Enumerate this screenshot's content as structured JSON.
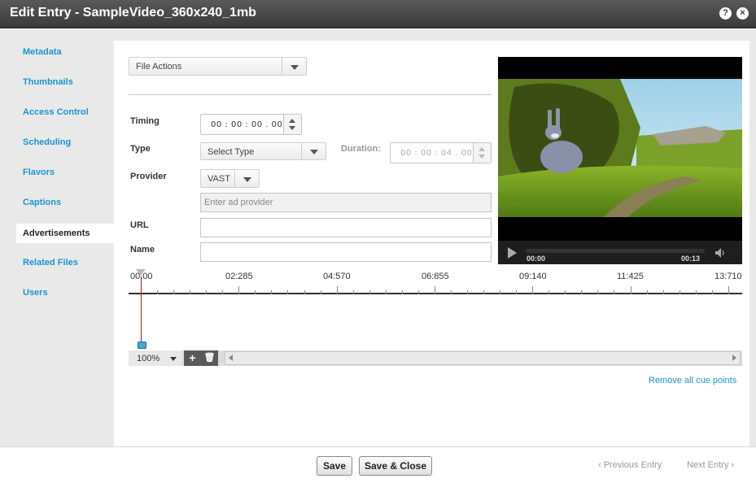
{
  "window": {
    "title": "Edit Entry - SampleVideo_360x240_1mb",
    "help_icon": "?",
    "close_icon": "×"
  },
  "sidebar": {
    "items": [
      {
        "label": "Metadata"
      },
      {
        "label": "Thumbnails"
      },
      {
        "label": "Access Control"
      },
      {
        "label": "Scheduling"
      },
      {
        "label": "Flavors"
      },
      {
        "label": "Captions"
      },
      {
        "label": "Advertisements",
        "active": true
      },
      {
        "label": "Related Files"
      },
      {
        "label": "Users"
      }
    ]
  },
  "file_actions": {
    "label": "File Actions"
  },
  "form": {
    "timing_label": "Timing",
    "timing_value": "00 : 00 : 00 . 000",
    "type_label": "Type",
    "type_value": "Select Type",
    "duration_label": "Duration:",
    "duration_value": "00 : 00 : 04 . 000",
    "provider_label": "Provider",
    "provider_value": "VAST",
    "provider_placeholder": "Enter ad provider",
    "url_label": "URL",
    "url_value": "",
    "name_label": "Name",
    "name_value": ""
  },
  "player": {
    "current_time": "00:00",
    "duration": "00:13"
  },
  "timeline": {
    "ticks": [
      "00:00",
      "02:285",
      "04:570",
      "06:855",
      "09:140",
      "11:425",
      "13:710"
    ],
    "zoom": "100%",
    "add_label": "+",
    "delete_label": "🗑"
  },
  "remove_all": "Remove all cue points",
  "footer": {
    "save": "Save",
    "save_close": "Save & Close",
    "previous": "‹ Previous Entry",
    "next": "Next Entry ›"
  },
  "colors": {
    "accent": "#1b94d2",
    "titlebar": "#454545",
    "playhead": "#a61818"
  }
}
